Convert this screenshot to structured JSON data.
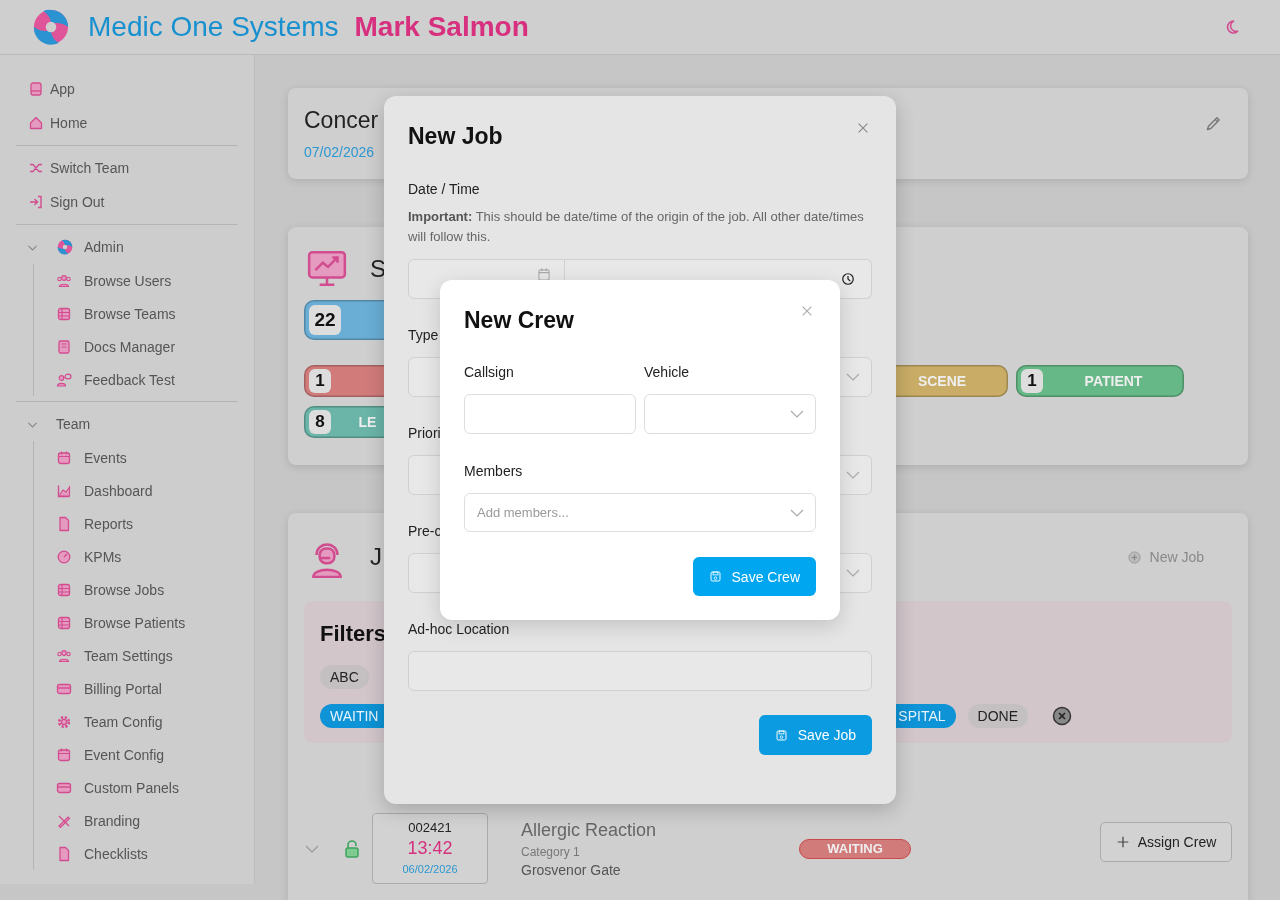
{
  "header": {
    "brand": "Medic One Systems",
    "user": "Mark Salmon"
  },
  "sidebar": {
    "groups": [
      {
        "items": [
          {
            "label": "App"
          },
          {
            "label": "Home"
          }
        ]
      },
      {
        "items": [
          {
            "label": "Switch Team"
          },
          {
            "label": "Sign Out"
          }
        ]
      },
      {
        "items": [
          {
            "label": "Admin",
            "expanded": true,
            "children": [
              {
                "label": "Browse Users"
              },
              {
                "label": "Browse Teams"
              },
              {
                "label": "Docs Manager"
              },
              {
                "label": "Feedback Test"
              }
            ]
          }
        ]
      },
      {
        "items": [
          {
            "label": "Team",
            "expanded": true,
            "children": [
              {
                "label": "Events"
              },
              {
                "label": "Dashboard"
              },
              {
                "label": "Reports"
              },
              {
                "label": "KPMs"
              },
              {
                "label": "Browse Jobs"
              },
              {
                "label": "Browse Patients"
              },
              {
                "label": "Team Settings"
              },
              {
                "label": "Billing Portal"
              },
              {
                "label": "Team Config"
              },
              {
                "label": "Event Config"
              },
              {
                "label": "Custom Panels"
              },
              {
                "label": "Branding"
              },
              {
                "label": "Checklists"
              }
            ]
          }
        ]
      }
    ]
  },
  "event_card": {
    "title": "Concer",
    "date": "07/02/2026"
  },
  "stats_card": {
    "title": "S",
    "rows": [
      [
        {
          "count": "22",
          "color": "#6aaed6"
        }
      ],
      [
        {
          "count": "1",
          "color": "#d27b7b"
        },
        {
          "label": "SCENE",
          "color": "#c9ad67"
        },
        {
          "count": "1",
          "label": "PATIENT",
          "color": "#66b886"
        }
      ],
      [
        {
          "count": "8",
          "label": "LE",
          "color": "#6ab5a8"
        }
      ]
    ]
  },
  "jobs_card": {
    "title": "J",
    "new_job": "New Job",
    "filters": {
      "title": "Filters",
      "chips_left": [
        {
          "label": "ABC",
          "selected": false
        }
      ],
      "chips_row2_left": [
        {
          "label": "WAITIN",
          "selected": true
        }
      ],
      "chips_row2_right": [
        {
          "label": "SPITAL",
          "selected": true
        },
        {
          "label": "DONE",
          "selected": false
        }
      ]
    },
    "jobs": [
      {
        "number": "002421",
        "time": "13:42",
        "date": "06/02/2026",
        "title": "Allergic Reaction",
        "category": "Category 1",
        "location": "Grosvenor Gate",
        "status": "WAITING",
        "color": "#d27b7b",
        "locked": false,
        "action": "Assign Crew"
      }
    ]
  },
  "new_job_dialog": {
    "title": "New Job",
    "date_time_label": "Date / Time",
    "note_bold": "Important:",
    "note": "This should be date/time of the origin of the job. All other date/times will follow this.",
    "type_label": "Type",
    "priority_label": "Priori",
    "pre_label": "Pre-c",
    "location_label": "Ad-hoc Location",
    "save": "Save Job"
  },
  "new_crew_dialog": {
    "title": "New Crew",
    "callsign_label": "Callsign",
    "vehicle_label": "Vehicle",
    "members_label": "Members",
    "members_placeholder": "Add members...",
    "save": "Save Crew"
  }
}
